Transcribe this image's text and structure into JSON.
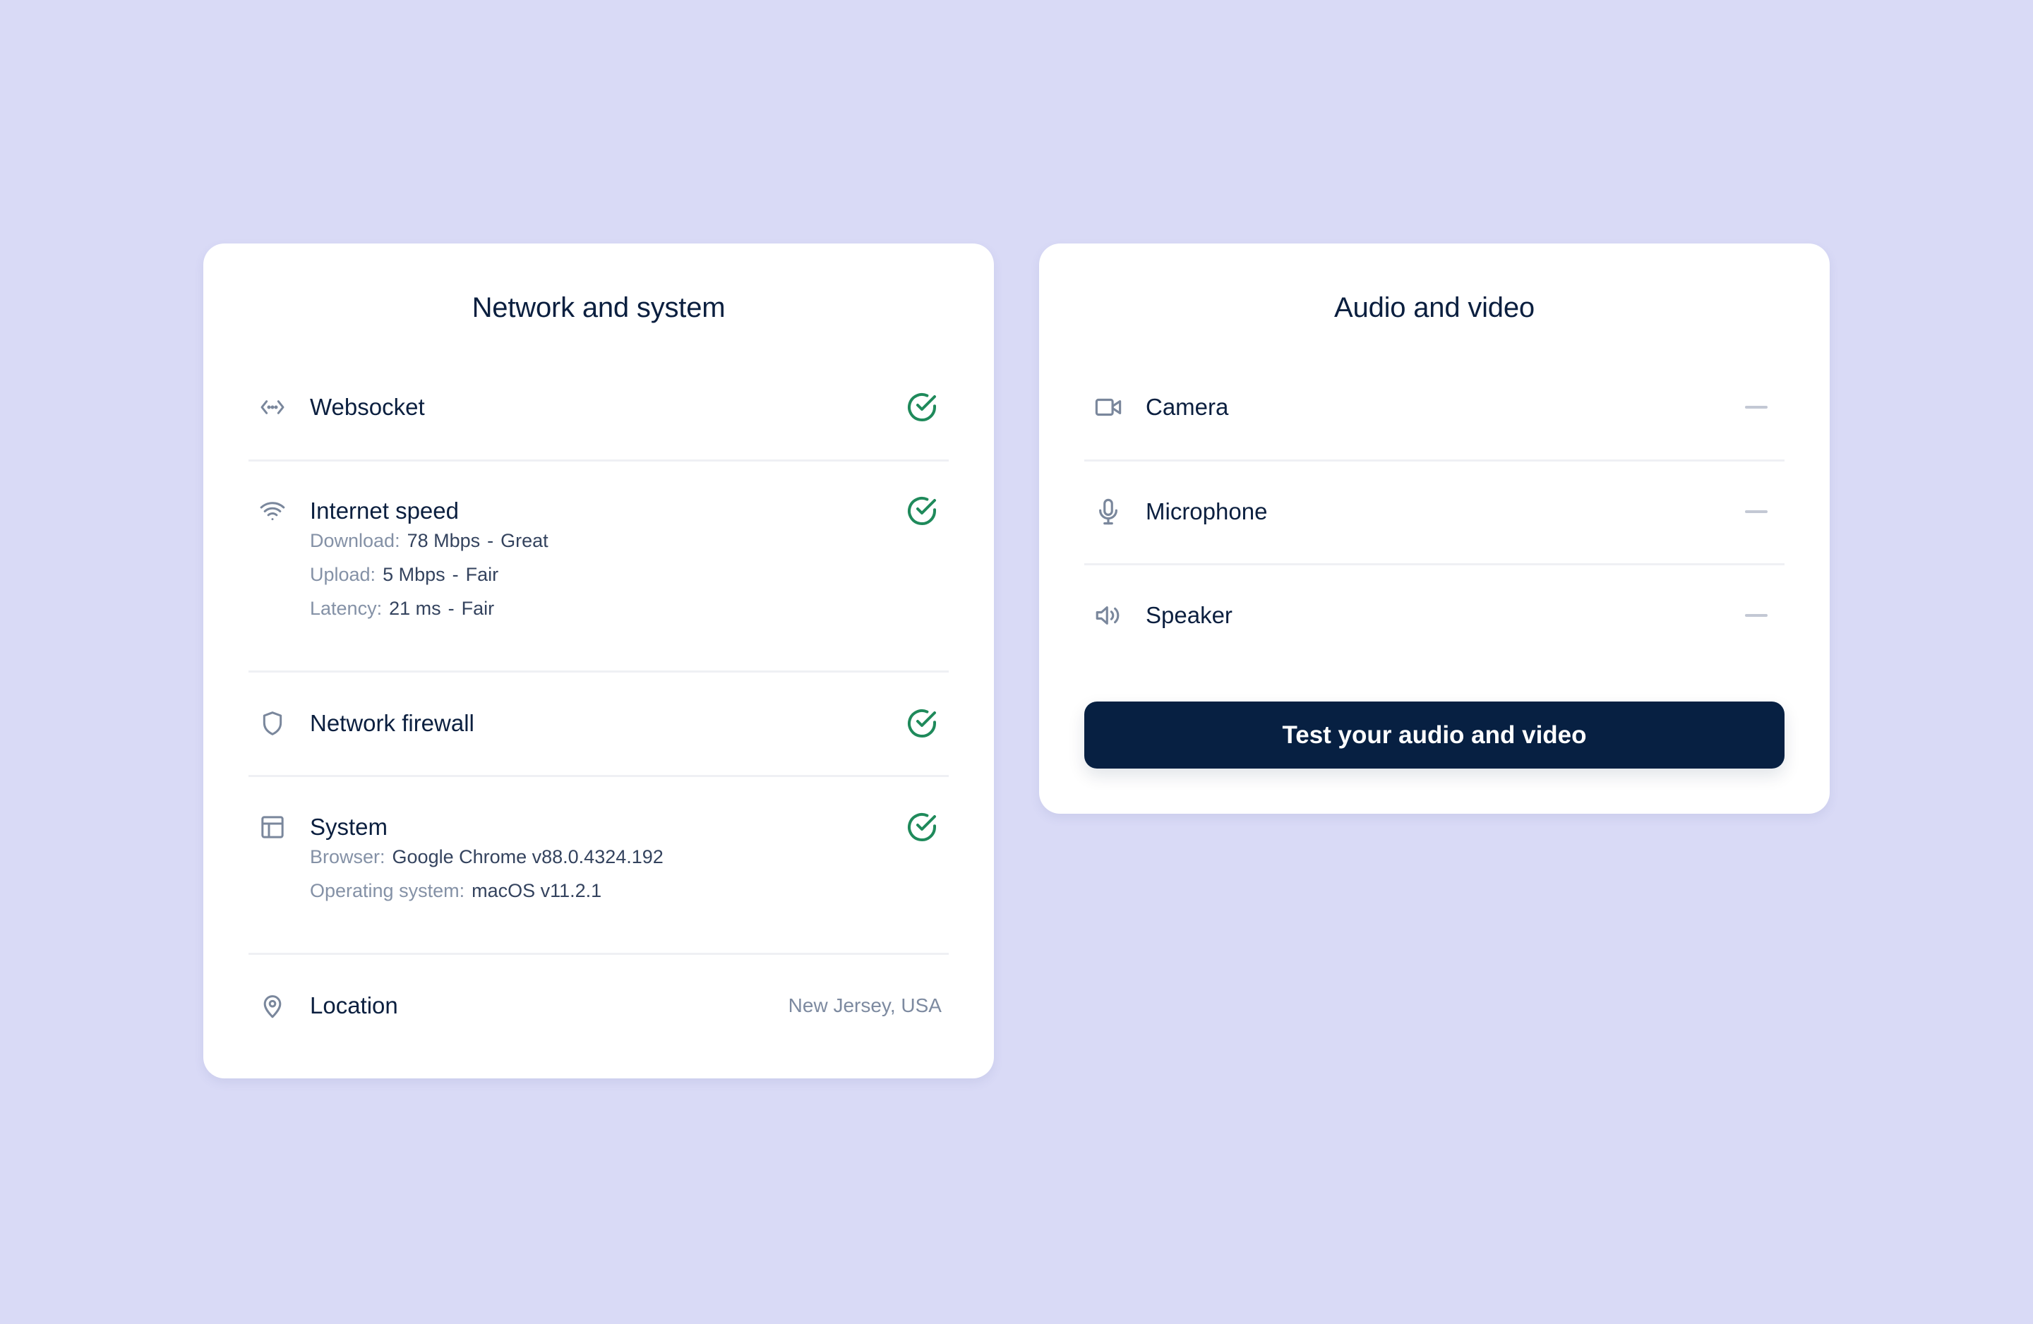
{
  "network_card": {
    "title": "Network and system",
    "websocket": {
      "label": "Websocket",
      "icon": "code-brackets-icon",
      "status": "passed"
    },
    "internet_speed": {
      "label": "Internet speed",
      "icon": "wifi-icon",
      "status": "passed",
      "details": [
        {
          "key": "Download:",
          "value": "78 Mbps",
          "separator": "-",
          "rating": "Great"
        },
        {
          "key": "Upload:",
          "value": "5 Mbps",
          "separator": "-",
          "rating": "Fair"
        },
        {
          "key": "Latency:",
          "value": "21 ms",
          "separator": "-",
          "rating": "Fair"
        }
      ]
    },
    "firewall": {
      "label": "Network firewall",
      "icon": "shield-icon",
      "status": "passed"
    },
    "system": {
      "label": "System",
      "icon": "layout-icon",
      "status": "passed",
      "details": [
        {
          "key": "Browser:",
          "value": "Google Chrome v88.0.4324.192"
        },
        {
          "key": "Operating system:",
          "value": "macOS v11.2.1"
        }
      ]
    },
    "location": {
      "label": "Location",
      "icon": "map-pin-icon",
      "value": "New Jersey, USA"
    }
  },
  "av_card": {
    "title": "Audio and video",
    "items": [
      {
        "label": "Camera",
        "icon": "video-camera-icon",
        "status": "pending"
      },
      {
        "label": "Microphone",
        "icon": "microphone-icon",
        "status": "pending"
      },
      {
        "label": "Speaker",
        "icon": "speaker-icon",
        "status": "pending"
      }
    ],
    "cta_label": "Test your audio and video"
  },
  "colors": {
    "background": "#d9daf6",
    "card": "#ffffff",
    "text_primary": "#0b1f3f",
    "text_secondary": "#8491a6",
    "icon": "#7a879c",
    "success": "#1f8a5b",
    "pending_dash": "#c3c8d4",
    "button": "#072042"
  }
}
